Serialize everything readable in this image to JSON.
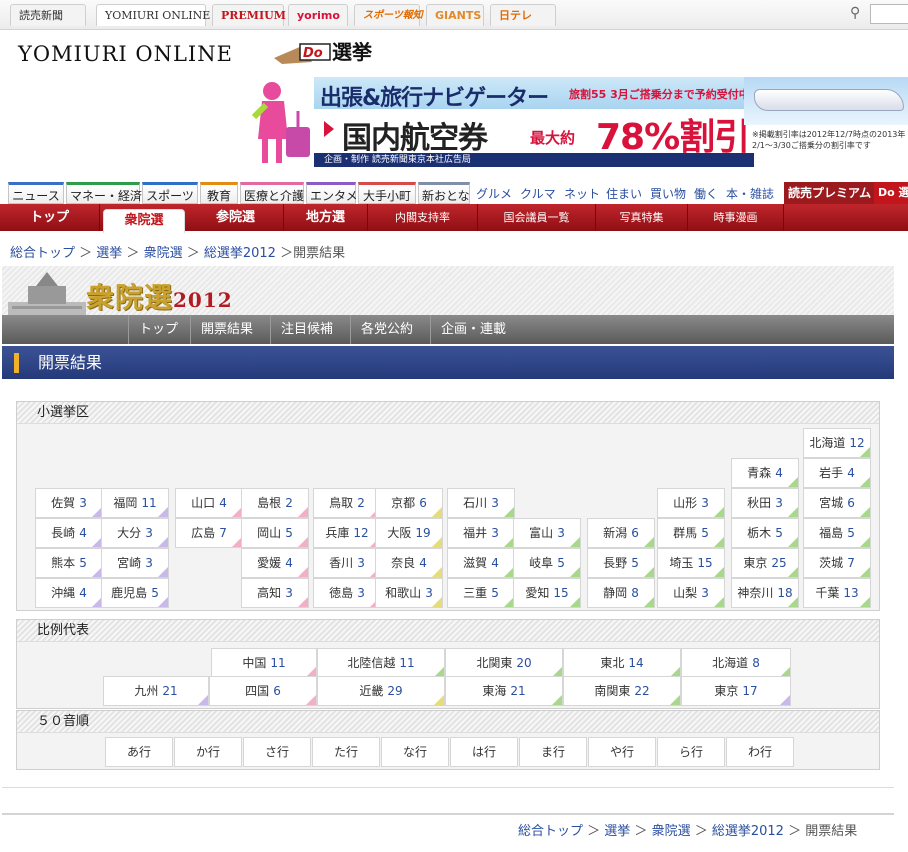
{
  "topbar": {
    "tabs": [
      "読売新聞",
      "YOMIURI ONLINE",
      "PREMIUM",
      "yorimo",
      "スポーツ報知",
      "GIANTS",
      "日テレ"
    ]
  },
  "logo": {
    "site": "YOMIURI ONLINE",
    "do_label": "Do 選挙"
  },
  "banner": {
    "line1": "出張&旅行ナビゲーター",
    "line1b": "旅割55 3月ご搭乗分まで予約受付中",
    "line2": "国内航空券",
    "line3": "最大約",
    "line4": "78%割引",
    "note": "※掲載割引率は2012年12/7時点の2013年2/1～3/30ご搭乗分の割引率です",
    "footer": "企画・制作 読売新聞東京本社広告局"
  },
  "nav": {
    "boxed": [
      "ニュース",
      "マネー・経済",
      "スポーツ",
      "教育",
      "医療と介護",
      "エンタメ",
      "大手小町",
      "新おとな"
    ],
    "links": [
      "グルメ",
      "クルマ",
      "ネット",
      "住まい",
      "買い物",
      "働く",
      "本・雑誌"
    ],
    "premium": "読売プレミアム",
    "do": "Do 選"
  },
  "redbar": {
    "items": [
      "トップ",
      "衆院選",
      "参院選",
      "地方選",
      "内閣支持率",
      "国会議員一覧",
      "写真特集",
      "時事漫画"
    ]
  },
  "breadcrumb": {
    "items": [
      "総合トップ",
      "選挙",
      "衆院選",
      "総選挙2012"
    ],
    "current": "開票結果"
  },
  "election": {
    "title": "衆院選",
    "year": "2012",
    "tabs": [
      "トップ",
      "開票結果",
      "注目候補",
      "各党公約",
      "企画・連載"
    ],
    "section": "開票結果"
  },
  "single_seat": {
    "title": "小選挙区",
    "prefectures": [
      {
        "name": "北海道",
        "n": "12"
      },
      {
        "name": "青森",
        "n": "4"
      },
      {
        "name": "岩手",
        "n": "4"
      },
      {
        "name": "佐賀",
        "n": "3"
      },
      {
        "name": "福岡",
        "n": "11"
      },
      {
        "name": "山口",
        "n": "4"
      },
      {
        "name": "島根",
        "n": "2"
      },
      {
        "name": "鳥取",
        "n": "2"
      },
      {
        "name": "京都",
        "n": "6"
      },
      {
        "name": "石川",
        "n": "3"
      },
      {
        "name": "山形",
        "n": "3"
      },
      {
        "name": "秋田",
        "n": "3"
      },
      {
        "name": "宮城",
        "n": "6"
      },
      {
        "name": "長崎",
        "n": "4"
      },
      {
        "name": "大分",
        "n": "3"
      },
      {
        "name": "広島",
        "n": "7"
      },
      {
        "name": "岡山",
        "n": "5"
      },
      {
        "name": "兵庫",
        "n": "12"
      },
      {
        "name": "大阪",
        "n": "19"
      },
      {
        "name": "福井",
        "n": "3"
      },
      {
        "name": "富山",
        "n": "3"
      },
      {
        "name": "新潟",
        "n": "6"
      },
      {
        "name": "群馬",
        "n": "5"
      },
      {
        "name": "栃木",
        "n": "5"
      },
      {
        "name": "福島",
        "n": "5"
      },
      {
        "name": "熊本",
        "n": "5"
      },
      {
        "name": "宮崎",
        "n": "3"
      },
      {
        "name": "愛媛",
        "n": "4"
      },
      {
        "name": "香川",
        "n": "3"
      },
      {
        "name": "奈良",
        "n": "4"
      },
      {
        "name": "滋賀",
        "n": "4"
      },
      {
        "name": "岐阜",
        "n": "5"
      },
      {
        "name": "長野",
        "n": "5"
      },
      {
        "name": "埼玉",
        "n": "15"
      },
      {
        "name": "東京",
        "n": "25"
      },
      {
        "name": "茨城",
        "n": "7"
      },
      {
        "name": "沖縄",
        "n": "4"
      },
      {
        "name": "鹿児島",
        "n": "5"
      },
      {
        "name": "高知",
        "n": "3"
      },
      {
        "name": "徳島",
        "n": "3"
      },
      {
        "name": "和歌山",
        "n": "3"
      },
      {
        "name": "三重",
        "n": "5"
      },
      {
        "name": "愛知",
        "n": "15"
      },
      {
        "name": "静岡",
        "n": "8"
      },
      {
        "name": "山梨",
        "n": "3"
      },
      {
        "name": "神奈川",
        "n": "18"
      },
      {
        "name": "千葉",
        "n": "13"
      }
    ]
  },
  "proportional": {
    "title": "比例代表",
    "blocks": [
      {
        "name": "中国",
        "n": "11",
        "color": "#f2b0c8"
      },
      {
        "name": "北陸信越",
        "n": "11",
        "color": "#a8d88a"
      },
      {
        "name": "北関東",
        "n": "20",
        "color": "#a8d88a"
      },
      {
        "name": "東北",
        "n": "14",
        "color": "#a8d88a"
      },
      {
        "name": "北海道",
        "n": "8",
        "color": "#a8d88a"
      },
      {
        "name": "九州",
        "n": "21",
        "color": "#c9b8ea"
      },
      {
        "name": "四国",
        "n": "6",
        "color": "#f2b0c8"
      },
      {
        "name": "近畿",
        "n": "29",
        "color": "#e6dc7a"
      },
      {
        "name": "東海",
        "n": "21",
        "color": "#a8d88a"
      },
      {
        "name": "南関東",
        "n": "22",
        "color": "#a8d88a"
      },
      {
        "name": "東京",
        "n": "17",
        "color": "#c9b8ea"
      }
    ]
  },
  "kana": {
    "title": "５０音順",
    "rows": [
      "あ行",
      "か行",
      "さ行",
      "た行",
      "な行",
      "は行",
      "ま行",
      "や行",
      "ら行",
      "わ行"
    ]
  },
  "footer_crumbs": {
    "items": [
      "総合トップ",
      "選挙",
      "衆院選",
      "総選挙2012"
    ],
    "current": "開票結果"
  },
  "colors": {
    "red": "#c3151c",
    "navy": "#24397a",
    "link": "#2a4fa0",
    "gold": "#c9a12e"
  }
}
